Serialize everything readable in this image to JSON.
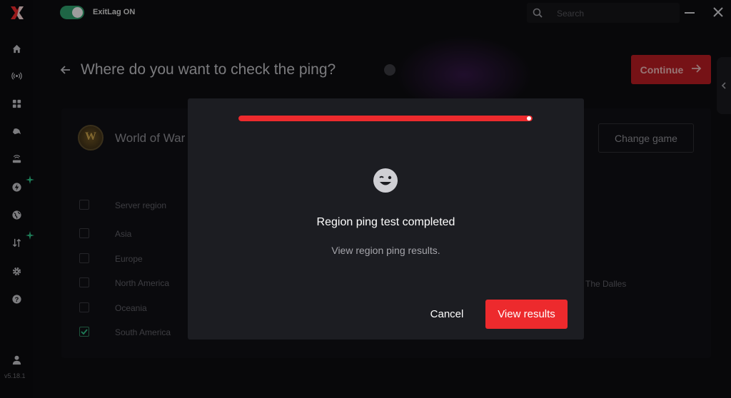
{
  "app": {
    "toggle_label": "ExitLag ON",
    "version": "v5.18.1",
    "accent_color": "#ed2a2d",
    "toggle_color": "#2e9c6a"
  },
  "search": {
    "placeholder": "Search",
    "icon": "search-icon"
  },
  "sidebar": {
    "items": [
      {
        "icon": "home-icon"
      },
      {
        "icon": "broadcast-icon"
      },
      {
        "icon": "grid-icon"
      },
      {
        "icon": "gamepad-icon"
      },
      {
        "icon": "router-icon"
      },
      {
        "icon": "bolt-icon",
        "badge": "sparkle-icon"
      },
      {
        "icon": "globe-icon"
      },
      {
        "icon": "transfer-icon",
        "badge": "sparkle-icon"
      },
      {
        "icon": "gear-icon"
      },
      {
        "icon": "help-icon"
      },
      {
        "icon": "user-icon"
      }
    ]
  },
  "page": {
    "title": "Where do you want to check the ping?",
    "continue_label": "Continue"
  },
  "game": {
    "name": "World of War",
    "change_label": "Change game"
  },
  "regions": {
    "header": "Server region",
    "items": [
      {
        "label": "Asia",
        "checked": false
      },
      {
        "label": "Europe",
        "checked": false
      },
      {
        "label": "North America",
        "checked": false
      },
      {
        "label": "Oceania",
        "checked": false
      },
      {
        "label": "South America",
        "checked": true
      }
    ],
    "extra_label": "The Dalles"
  },
  "modal": {
    "progress": 1.0,
    "icon": "winking-face-icon",
    "title": "Region ping test completed",
    "subtitle": "View region ping results.",
    "cancel_label": "Cancel",
    "results_label": "View results"
  }
}
